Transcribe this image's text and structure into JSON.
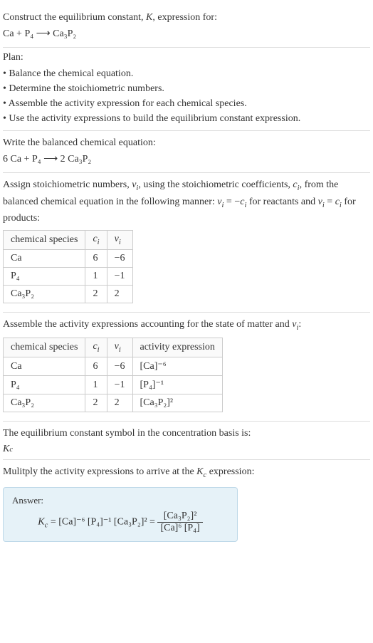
{
  "intro": {
    "prompt_prefix": "Construct the equilibrium constant, ",
    "k_symbol": "K",
    "prompt_suffix": ", expression for:",
    "unbalanced_equation": "Ca + P₄ ⟶ Ca₃P₂"
  },
  "plan": {
    "title": "Plan:",
    "items": [
      "• Balance the chemical equation.",
      "• Determine the stoichiometric numbers.",
      "• Assemble the activity expression for each chemical species.",
      "• Use the activity expressions to build the equilibrium constant expression."
    ]
  },
  "balanced": {
    "instruction": "Write the balanced chemical equation:",
    "equation": "6 Ca + P₄ ⟶ 2 Ca₃P₂"
  },
  "assign": {
    "text_a": "Assign stoichiometric numbers, ",
    "nu_i": "ν",
    "text_b": ", using the stoichiometric coefficients, ",
    "c_i": "c",
    "text_c": ", from the balanced chemical equation in the following manner: ",
    "rel1_a": "ν",
    "rel1_b": " = −",
    "rel1_c": "c",
    "text_d": " for reactants and ",
    "rel2_a": "ν",
    "rel2_b": " = ",
    "rel2_c": "c",
    "text_e": " for products:",
    "i": "i",
    "table1": {
      "headers": {
        "species": "chemical species",
        "ci": "c",
        "nui": "ν"
      },
      "rows": [
        {
          "species": "Ca",
          "ci": "6",
          "nui": "−6"
        },
        {
          "species": "P₄",
          "ci": "1",
          "nui": "−1"
        },
        {
          "species": "Ca₃P₂",
          "ci": "2",
          "nui": "2"
        }
      ]
    }
  },
  "activity": {
    "text_a": "Assemble the activity expressions accounting for the state of matter and ",
    "nu_i": "ν",
    "text_b": ":",
    "i": "i",
    "table2": {
      "headers": {
        "species": "chemical species",
        "ci": "c",
        "nui": "ν",
        "act": "activity expression"
      },
      "rows": [
        {
          "species": "Ca",
          "ci": "6",
          "nui": "−6",
          "act": "[Ca]⁻⁶"
        },
        {
          "species": "P₄",
          "ci": "1",
          "nui": "−1",
          "act": "[P₄]⁻¹"
        },
        {
          "species": "Ca₃P₂",
          "ci": "2",
          "nui": "2",
          "act": "[Ca₃P₂]²"
        }
      ]
    }
  },
  "kc_symbol_section": {
    "text": "The equilibrium constant symbol in the concentration basis is:",
    "symbol_k": "K",
    "symbol_c": "c"
  },
  "multiply": {
    "text_a": "Mulitply the activity expressions to arrive at the ",
    "k": "K",
    "c": "c",
    "text_b": " expression:"
  },
  "answer": {
    "label": "Answer:",
    "lhs_k": "K",
    "lhs_c": "c",
    "eq1": " = [Ca]⁻⁶ [P₄]⁻¹ [Ca₃P₂]² = ",
    "frac_num": "[Ca₃P₂]²",
    "frac_den": "[Ca]⁶ [P₄]"
  },
  "chart_data": {
    "type": "table",
    "stoichiometric_table": {
      "columns": [
        "chemical species",
        "c_i",
        "ν_i"
      ],
      "rows": [
        [
          "Ca",
          6,
          -6
        ],
        [
          "P₄",
          1,
          -1
        ],
        [
          "Ca₃P₂",
          2,
          2
        ]
      ]
    },
    "activity_table": {
      "columns": [
        "chemical species",
        "c_i",
        "ν_i",
        "activity expression"
      ],
      "rows": [
        [
          "Ca",
          6,
          -6,
          "[Ca]^-6"
        ],
        [
          "P₄",
          1,
          -1,
          "[P₄]^-1"
        ],
        [
          "Ca₃P₂",
          2,
          2,
          "[Ca₃P₂]^2"
        ]
      ]
    }
  }
}
